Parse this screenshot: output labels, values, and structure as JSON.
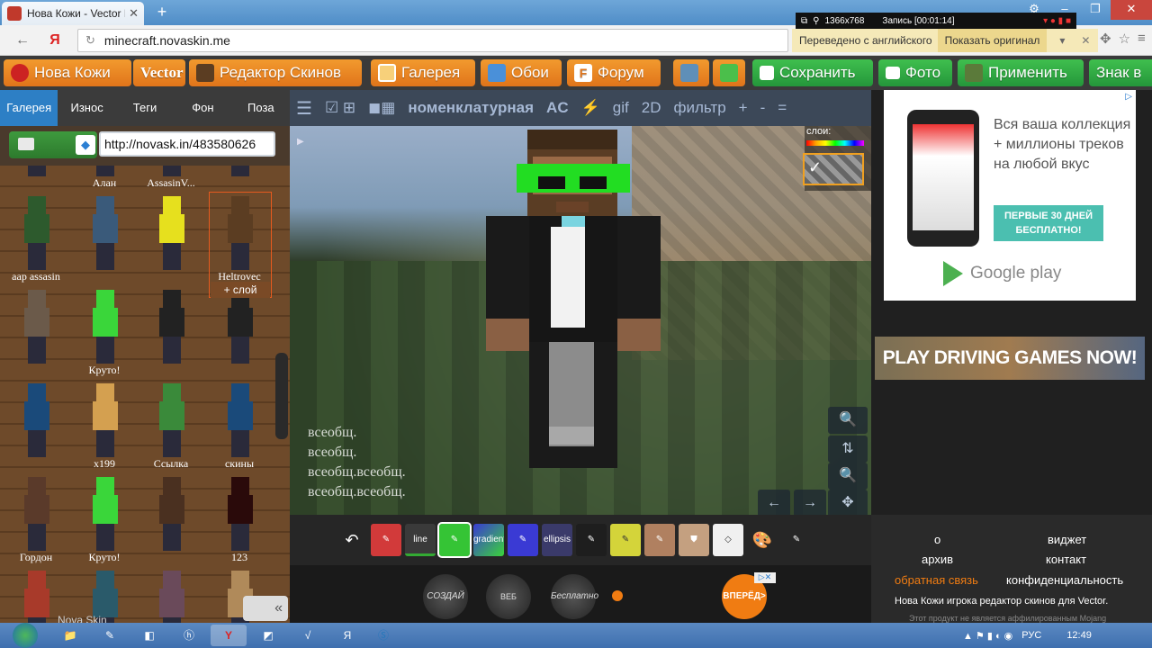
{
  "browser": {
    "tab_title": "Нова Кожи - Vector P...",
    "new_tab": "+",
    "url": "minecraft.novaskin.me",
    "translated_label": "Переведено с английского",
    "show_original": "Показать оригинал",
    "yandex_logo": "Я"
  },
  "recorder": {
    "resolution": "1366x768",
    "record_label": "Запись [00:01:14]"
  },
  "site_toolbar": {
    "home": "Нова Кожи",
    "vector": "Vector",
    "editor": "Редактор Скинов",
    "gallery": "Галерея",
    "wallpapers": "Обои",
    "forum": "Форум",
    "save": "Сохранить",
    "photo": "Фото",
    "apply": "Применить",
    "badge": "Знак в"
  },
  "left_panel": {
    "tabs": [
      "Галерея",
      "Износ",
      "Теги",
      "Фон",
      "Поза"
    ],
    "active_tab": 0,
    "url_input": "http://novask.in/483580626",
    "add_layer": "+ слой",
    "collapse": "«",
    "watermark": "Nova Skin",
    "rows": [
      {
        "items": [
          {
            "name": "",
            "head": "#333"
          },
          {
            "name": "Алан",
            "head": "#5a4a3a"
          },
          {
            "name": "AssasinV...",
            "head": "#6a6a6a"
          },
          {
            "name": "",
            "head": "#5b3d22"
          }
        ]
      },
      {
        "items": [
          {
            "name": "aap assasin",
            "head": "#2d5a2d"
          },
          {
            "name": "",
            "head": "#3a5a7a"
          },
          {
            "name": "",
            "head": "#e6e01e"
          },
          {
            "name": "Heltrovec",
            "head": "#5b3d22"
          }
        ]
      },
      {
        "items": [
          {
            "name": "",
            "head": "#6b5a4a"
          },
          {
            "name": "Круто!",
            "head": "#3ad63a"
          },
          {
            "name": "",
            "head": "#222"
          },
          {
            "name": "",
            "head": "#222"
          }
        ]
      },
      {
        "items": [
          {
            "name": "",
            "head": "#1a4a7a"
          },
          {
            "name": "x199",
            "head": "#d4a050"
          },
          {
            "name": "Ссылка",
            "head": "#3a8a3a"
          },
          {
            "name": "скины",
            "head": "#1a4a7a"
          }
        ]
      },
      {
        "items": [
          {
            "name": "Гордон",
            "head": "#5a3a2a"
          },
          {
            "name": "Круто!",
            "head": "#3ad63a"
          },
          {
            "name": "",
            "head": "#4a3020"
          },
          {
            "name": "123",
            "head": "#2a0a0a"
          }
        ]
      },
      {
        "items": [
          {
            "name": "",
            "head": "#a83a2a"
          },
          {
            "name": "",
            "head": "#2a5a6a"
          },
          {
            "name": "",
            "head": "#6a4a5a"
          },
          {
            "name": "",
            "head": "#b08a5a"
          }
        ]
      }
    ]
  },
  "editor_toolbar": {
    "menu": "☰",
    "nomenclature": "номенклатурная",
    "ac": "AC",
    "gif": "gif",
    "mode_2d": "2D",
    "filter": "фильтр",
    "plus": "+",
    "minus": "-",
    "equals": "="
  },
  "viewport": {
    "layers_label": "слои:",
    "ghost_text": [
      "всеобщ.",
      "всеобщ.",
      "всеобщ.всеобщ.",
      "всеобщ.всеобщ."
    ]
  },
  "paint_tools": [
    "↶",
    "pencil",
    "line",
    "spray",
    "gradient",
    "brush",
    "ellipsis",
    "dropper",
    "noise",
    "darken",
    "fill",
    "eraser",
    "palette",
    "picker"
  ],
  "paint_tool_labels": {
    "line": "line",
    "gradient": "gradient",
    "ellipsis": "ellipsis"
  },
  "bottom_ad": {
    "create": "СОЗДАЙ",
    "web": "ВЕБ САЙТЫ",
    "free": "Бесплатно",
    "forward": "ВПЕРЁД>"
  },
  "ad_right": {
    "text": "Вся ваша коллекция + миллионы треков на любой вкус",
    "button": "ПЕРВЫЕ 30 ДНЕЙ БЕСПЛАТНО!",
    "store": "Google play"
  },
  "ad_banner": {
    "text": "PLAY DRIVING GAMES NOW!"
  },
  "footer": {
    "about": "о",
    "widget": "виджет",
    "archive": "архив",
    "contact": "контакт",
    "feedback": "обратная связь",
    "privacy": "конфиденциальность",
    "tagline": "Нова Кожи игрока редактор скинов для",
    "vector": "Vector",
    "disclaimer": "Этот продукт не является аффилированным Mojang"
  },
  "taskbar": {
    "lang": "РУС",
    "time": "12:49"
  },
  "colors": {
    "accent_orange": "#e0741a",
    "accent_green": "#24963a",
    "active_tab": "#2d7fc5"
  }
}
